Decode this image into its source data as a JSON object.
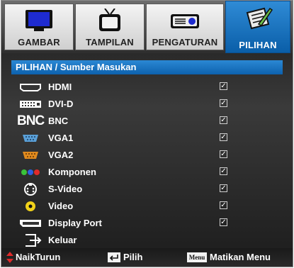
{
  "tabs": [
    {
      "label": "GAMBAR",
      "icon": "monitor-icon",
      "active": false
    },
    {
      "label": "TAMPILAN",
      "icon": "tv-icon",
      "active": false
    },
    {
      "label": "PENGATURAN",
      "icon": "projector-icon",
      "active": false
    },
    {
      "label": "PILIHAN",
      "icon": "notepad-pen-icon",
      "active": true
    }
  ],
  "title": "PILIHAN / Sumber Masukan",
  "items": [
    {
      "label": "HDMI",
      "icon": "hdmi-port-icon",
      "checked": true,
      "check_char": "✓"
    },
    {
      "label": "DVI-D",
      "icon": "dvi-port-icon",
      "checked": true,
      "check_char": "✓"
    },
    {
      "label": "BNC",
      "icon": "bnc-icon",
      "icon_text": "BNC",
      "checked": true,
      "check_char": "✓"
    },
    {
      "label": "VGA1",
      "icon": "vga-port-icon",
      "checked": true,
      "check_char": "✓"
    },
    {
      "label": "VGA2",
      "icon": "vga-port-icon",
      "checked": true,
      "check_char": "✓"
    },
    {
      "label": "Komponen",
      "icon": "component-rgb-icon",
      "checked": true,
      "check_char": "✓"
    },
    {
      "label": "S-Video",
      "icon": "s-video-icon",
      "checked": true,
      "check_char": "✓"
    },
    {
      "label": "Video",
      "icon": "video-rca-icon",
      "checked": true,
      "check_char": "✓"
    },
    {
      "label": "Display Port",
      "icon": "displayport-icon",
      "checked": true,
      "check_char": "✓"
    },
    {
      "label": "Keluar",
      "icon": "exit-icon",
      "checked": null
    }
  ],
  "footer": {
    "updown": "NaikTurun",
    "select": "Pilih",
    "menu_key": "Menu",
    "menu_exit": "Matikan Menu"
  },
  "colors": {
    "accent": "#0d61ad",
    "vga1": "#5aa0d8",
    "vga2": "#e08a1e"
  }
}
